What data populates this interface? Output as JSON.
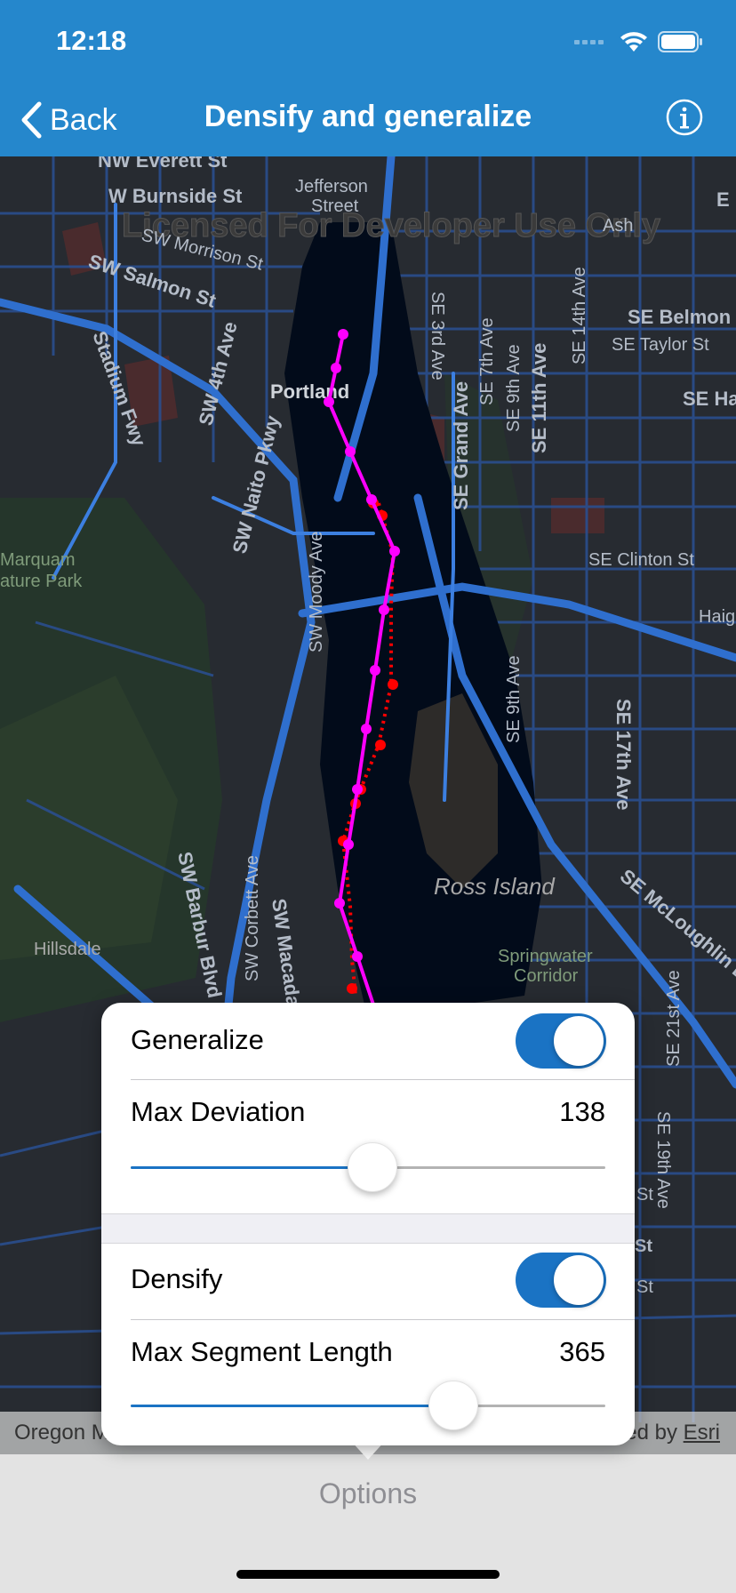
{
  "status_bar": {
    "time": "12:18",
    "icons": [
      "cellular-icon",
      "wifi-icon",
      "battery-icon"
    ]
  },
  "nav": {
    "back_label": "Back",
    "title": "Densify and generalize",
    "info_icon": "info-icon"
  },
  "map": {
    "watermark": "Licensed For Developer Use Only",
    "labels": {
      "nw_everett": "NW Everett St",
      "w_burnside": "W Burnside St",
      "jefferson": "Jefferson",
      "street": "Street",
      "sw_morrison": "SW Morrison St",
      "sw_salmon": "SW Salmon St",
      "stadium_fwy": "Stadium Fwy",
      "sw_4th": "SW 4th Ave",
      "portland": "Portland",
      "sw_naito": "SW Naito Pkwy",
      "se_3rd": "SE 3rd Ave",
      "se_7th": "SE 7th Ave",
      "se_9th": "SE 9th Ave",
      "se_11th": "SE 11th Ave",
      "se_14th": "SE 14th Ave",
      "se_belmont": "SE Belmon",
      "se_taylor": "SE Taylor St",
      "se_ha": "SE Ha",
      "se_grand": "SE Grand Ave",
      "marquam": "Marquam",
      "nature_park": "ature Park",
      "sw_moody": "SW Moody Ave",
      "se_clinton": "SE Clinton St",
      "haig": "Haig",
      "se_9th_b": "SE 9th Ave",
      "se_17th": "SE 17th Ave",
      "ross_island": "Ross Island",
      "se_mcloughlin": "SE McLoughlin Blvd",
      "sw_barbur": "SW Barbur Blvd",
      "sw_corbett": "SW Corbett Ave",
      "sw_macada": "SW Macada",
      "hillsdale": "Hillsdale",
      "springwater": "Springwater",
      "corridor": "Corridor",
      "se_21st": "SE 21st Ave",
      "se_19th": "SE 19th Ave",
      "e_edge": "E",
      "ash": "Ash",
      "st_a": "St",
      "st_b": "St",
      "st_c": "St"
    },
    "attribution_left": "Oregon M",
    "attribution_right_prefix": "ed by ",
    "attribution_right_link": "Esri",
    "colors": {
      "generalized_line": "#ff00ff",
      "densified_points": "#ff0000",
      "roads": "#2f6fce",
      "water": "#020b1a"
    }
  },
  "panel": {
    "generalize": {
      "label": "Generalize",
      "enabled": true
    },
    "max_deviation": {
      "label": "Max Deviation",
      "value": "138",
      "fraction": 0.51
    },
    "densify": {
      "label": "Densify",
      "enabled": true
    },
    "max_segment_length": {
      "label": "Max Segment Length",
      "value": "365",
      "fraction": 0.68
    }
  },
  "toolbar": {
    "options_label": "Options"
  }
}
